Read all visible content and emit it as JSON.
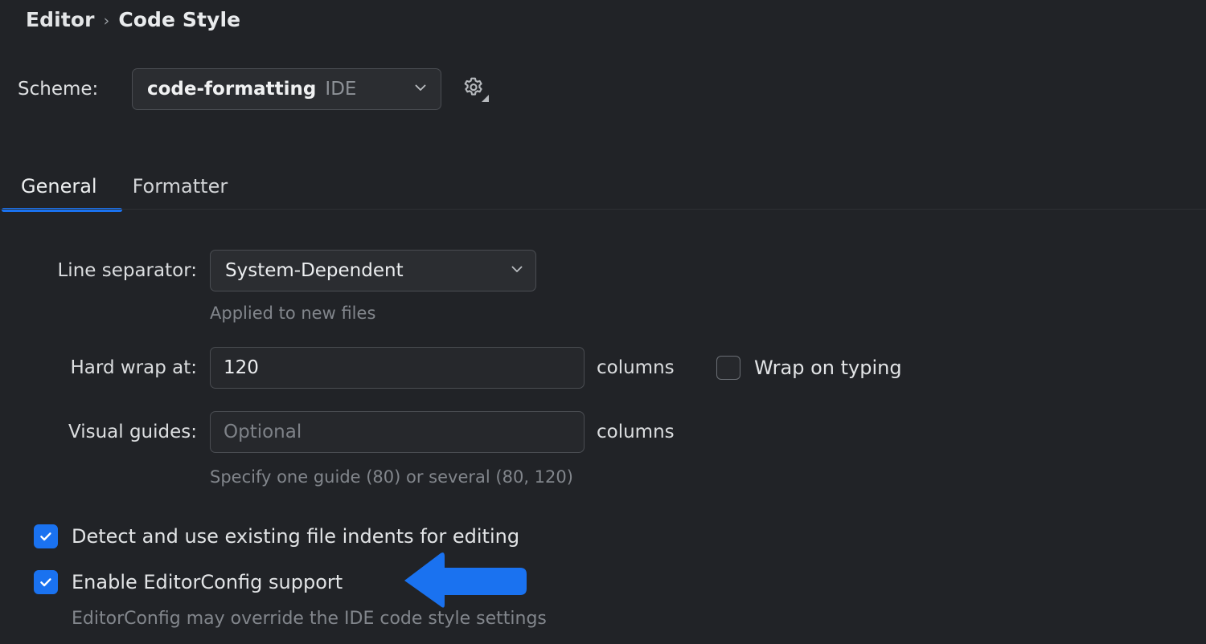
{
  "breadcrumb": {
    "root": "Editor",
    "separator": "›",
    "leaf": "Code Style"
  },
  "scheme": {
    "label": "Scheme:",
    "value": "code-formatting",
    "kind": "IDE",
    "chevron_icon": "chevron-down-icon",
    "gear_icon": "gear-icon"
  },
  "tabs": [
    {
      "label": "General",
      "active": true
    },
    {
      "label": "Formatter",
      "active": false
    }
  ],
  "form": {
    "line_separator": {
      "label": "Line separator:",
      "value": "System-Dependent",
      "hint": "Applied to new files"
    },
    "hard_wrap": {
      "label": "Hard wrap at:",
      "value": "120",
      "suffix": "columns"
    },
    "wrap_on_typing": {
      "label": "Wrap on typing",
      "checked": false
    },
    "visual_guides": {
      "label": "Visual guides:",
      "value": "",
      "placeholder": "Optional",
      "suffix": "columns",
      "hint": "Specify one guide (80) or several (80, 120)"
    },
    "detect_indents": {
      "label": "Detect and use existing file indents for editing",
      "checked": true
    },
    "editorconfig": {
      "label": "Enable EditorConfig support",
      "checked": true,
      "hint": "EditorConfig may override the IDE code style settings"
    }
  },
  "annotation": {
    "arrow_icon": "arrow-left-annotation",
    "color": "#1a72f0"
  },
  "colors": {
    "background": "#212327",
    "accent": "#1a72f0",
    "field_background": "#2b2d31",
    "border": "#4a4d52",
    "text": "#e2e4e6",
    "muted_text": "#82868c"
  }
}
